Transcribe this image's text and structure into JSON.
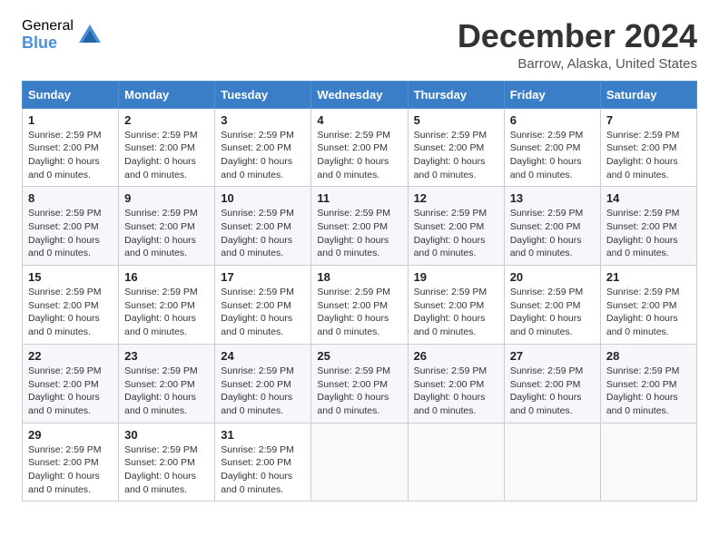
{
  "logo": {
    "general": "General",
    "blue": "Blue"
  },
  "header": {
    "title": "December 2024",
    "subtitle": "Barrow, Alaska, United States"
  },
  "calendar": {
    "days_of_week": [
      "Sunday",
      "Monday",
      "Tuesday",
      "Wednesday",
      "Thursday",
      "Friday",
      "Saturday"
    ],
    "cell_info": "Sunrise: 2:59 PM\nSunset: 2:00 PM\nDaylight: 0 hours\nand 0 minutes.",
    "weeks": [
      [
        {
          "day": "1",
          "info": "Sunrise: 2:59 PM\nSunset: 2:00 PM\nDaylight: 0 hours\nand 0 minutes."
        },
        {
          "day": "2",
          "info": "Sunrise: 2:59 PM\nSunset: 2:00 PM\nDaylight: 0 hours\nand 0 minutes."
        },
        {
          "day": "3",
          "info": "Sunrise: 2:59 PM\nSunset: 2:00 PM\nDaylight: 0 hours\nand 0 minutes."
        },
        {
          "day": "4",
          "info": "Sunrise: 2:59 PM\nSunset: 2:00 PM\nDaylight: 0 hours\nand 0 minutes."
        },
        {
          "day": "5",
          "info": "Sunrise: 2:59 PM\nSunset: 2:00 PM\nDaylight: 0 hours\nand 0 minutes."
        },
        {
          "day": "6",
          "info": "Sunrise: 2:59 PM\nSunset: 2:00 PM\nDaylight: 0 hours\nand 0 minutes."
        },
        {
          "day": "7",
          "info": "Sunrise: 2:59 PM\nSunset: 2:00 PM\nDaylight: 0 hours\nand 0 minutes."
        }
      ],
      [
        {
          "day": "8",
          "info": "Sunrise: 2:59 PM\nSunset: 2:00 PM\nDaylight: 0 hours\nand 0 minutes."
        },
        {
          "day": "9",
          "info": "Sunrise: 2:59 PM\nSunset: 2:00 PM\nDaylight: 0 hours\nand 0 minutes."
        },
        {
          "day": "10",
          "info": "Sunrise: 2:59 PM\nSunset: 2:00 PM\nDaylight: 0 hours\nand 0 minutes."
        },
        {
          "day": "11",
          "info": "Sunrise: 2:59 PM\nSunset: 2:00 PM\nDaylight: 0 hours\nand 0 minutes."
        },
        {
          "day": "12",
          "info": "Sunrise: 2:59 PM\nSunset: 2:00 PM\nDaylight: 0 hours\nand 0 minutes."
        },
        {
          "day": "13",
          "info": "Sunrise: 2:59 PM\nSunset: 2:00 PM\nDaylight: 0 hours\nand 0 minutes."
        },
        {
          "day": "14",
          "info": "Sunrise: 2:59 PM\nSunset: 2:00 PM\nDaylight: 0 hours\nand 0 minutes."
        }
      ],
      [
        {
          "day": "15",
          "info": "Sunrise: 2:59 PM\nSunset: 2:00 PM\nDaylight: 0 hours\nand 0 minutes."
        },
        {
          "day": "16",
          "info": "Sunrise: 2:59 PM\nSunset: 2:00 PM\nDaylight: 0 hours\nand 0 minutes."
        },
        {
          "day": "17",
          "info": "Sunrise: 2:59 PM\nSunset: 2:00 PM\nDaylight: 0 hours\nand 0 minutes."
        },
        {
          "day": "18",
          "info": "Sunrise: 2:59 PM\nSunset: 2:00 PM\nDaylight: 0 hours\nand 0 minutes."
        },
        {
          "day": "19",
          "info": "Sunrise: 2:59 PM\nSunset: 2:00 PM\nDaylight: 0 hours\nand 0 minutes."
        },
        {
          "day": "20",
          "info": "Sunrise: 2:59 PM\nSunset: 2:00 PM\nDaylight: 0 hours\nand 0 minutes."
        },
        {
          "day": "21",
          "info": "Sunrise: 2:59 PM\nSunset: 2:00 PM\nDaylight: 0 hours\nand 0 minutes."
        }
      ],
      [
        {
          "day": "22",
          "info": "Sunrise: 2:59 PM\nSunset: 2:00 PM\nDaylight: 0 hours\nand 0 minutes."
        },
        {
          "day": "23",
          "info": "Sunrise: 2:59 PM\nSunset: 2:00 PM\nDaylight: 0 hours\nand 0 minutes."
        },
        {
          "day": "24",
          "info": "Sunrise: 2:59 PM\nSunset: 2:00 PM\nDaylight: 0 hours\nand 0 minutes."
        },
        {
          "day": "25",
          "info": "Sunrise: 2:59 PM\nSunset: 2:00 PM\nDaylight: 0 hours\nand 0 minutes."
        },
        {
          "day": "26",
          "info": "Sunrise: 2:59 PM\nSunset: 2:00 PM\nDaylight: 0 hours\nand 0 minutes."
        },
        {
          "day": "27",
          "info": "Sunrise: 2:59 PM\nSunset: 2:00 PM\nDaylight: 0 hours\nand 0 minutes."
        },
        {
          "day": "28",
          "info": "Sunrise: 2:59 PM\nSunset: 2:00 PM\nDaylight: 0 hours\nand 0 minutes."
        }
      ],
      [
        {
          "day": "29",
          "info": "Sunrise: 2:59 PM\nSunset: 2:00 PM\nDaylight: 0 hours\nand 0 minutes."
        },
        {
          "day": "30",
          "info": "Sunrise: 2:59 PM\nSunset: 2:00 PM\nDaylight: 0 hours\nand 0 minutes."
        },
        {
          "day": "31",
          "info": "Sunrise: 2:59 PM\nSunset: 2:00 PM\nDaylight: 0 hours\nand 0 minutes."
        },
        {
          "day": "",
          "info": ""
        },
        {
          "day": "",
          "info": ""
        },
        {
          "day": "",
          "info": ""
        },
        {
          "day": "",
          "info": ""
        }
      ]
    ]
  }
}
